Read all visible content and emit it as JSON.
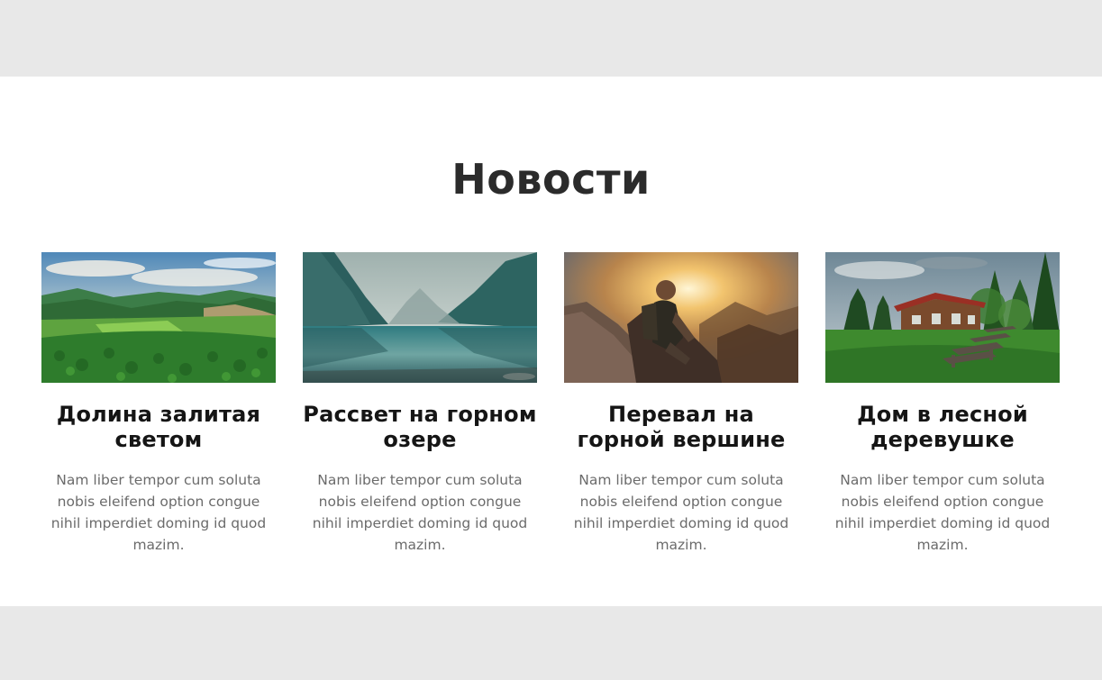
{
  "section": {
    "title": "Новости"
  },
  "news": [
    {
      "title": "Долина залитая светом",
      "text": "Nam liber tempor cum soluta nobis eleifend option congue nihil imperdiet doming id quod mazim.",
      "image_icon": "valley-landscape-image"
    },
    {
      "title": "Рассвет на горном озере",
      "text": "Nam liber tempor cum soluta nobis eleifend option congue nihil imperdiet doming id quod mazim.",
      "image_icon": "mountain-lake-image"
    },
    {
      "title": "Перевал на горной вершине",
      "text": "Nam liber tempor cum soluta nobis eleifend option congue nihil imperdiet doming id quod mazim.",
      "image_icon": "mountain-hiker-image"
    },
    {
      "title": "Дом в лесной деревушке",
      "text": "Nam liber tempor cum soluta nobis eleifend option congue nihil imperdiet doming id quod mazim.",
      "image_icon": "forest-house-image"
    }
  ],
  "colors": {
    "page_background": "#e8e8e8",
    "section_background": "#ffffff",
    "title_text": "#2b2b2b",
    "body_text": "#6b6b6b"
  }
}
